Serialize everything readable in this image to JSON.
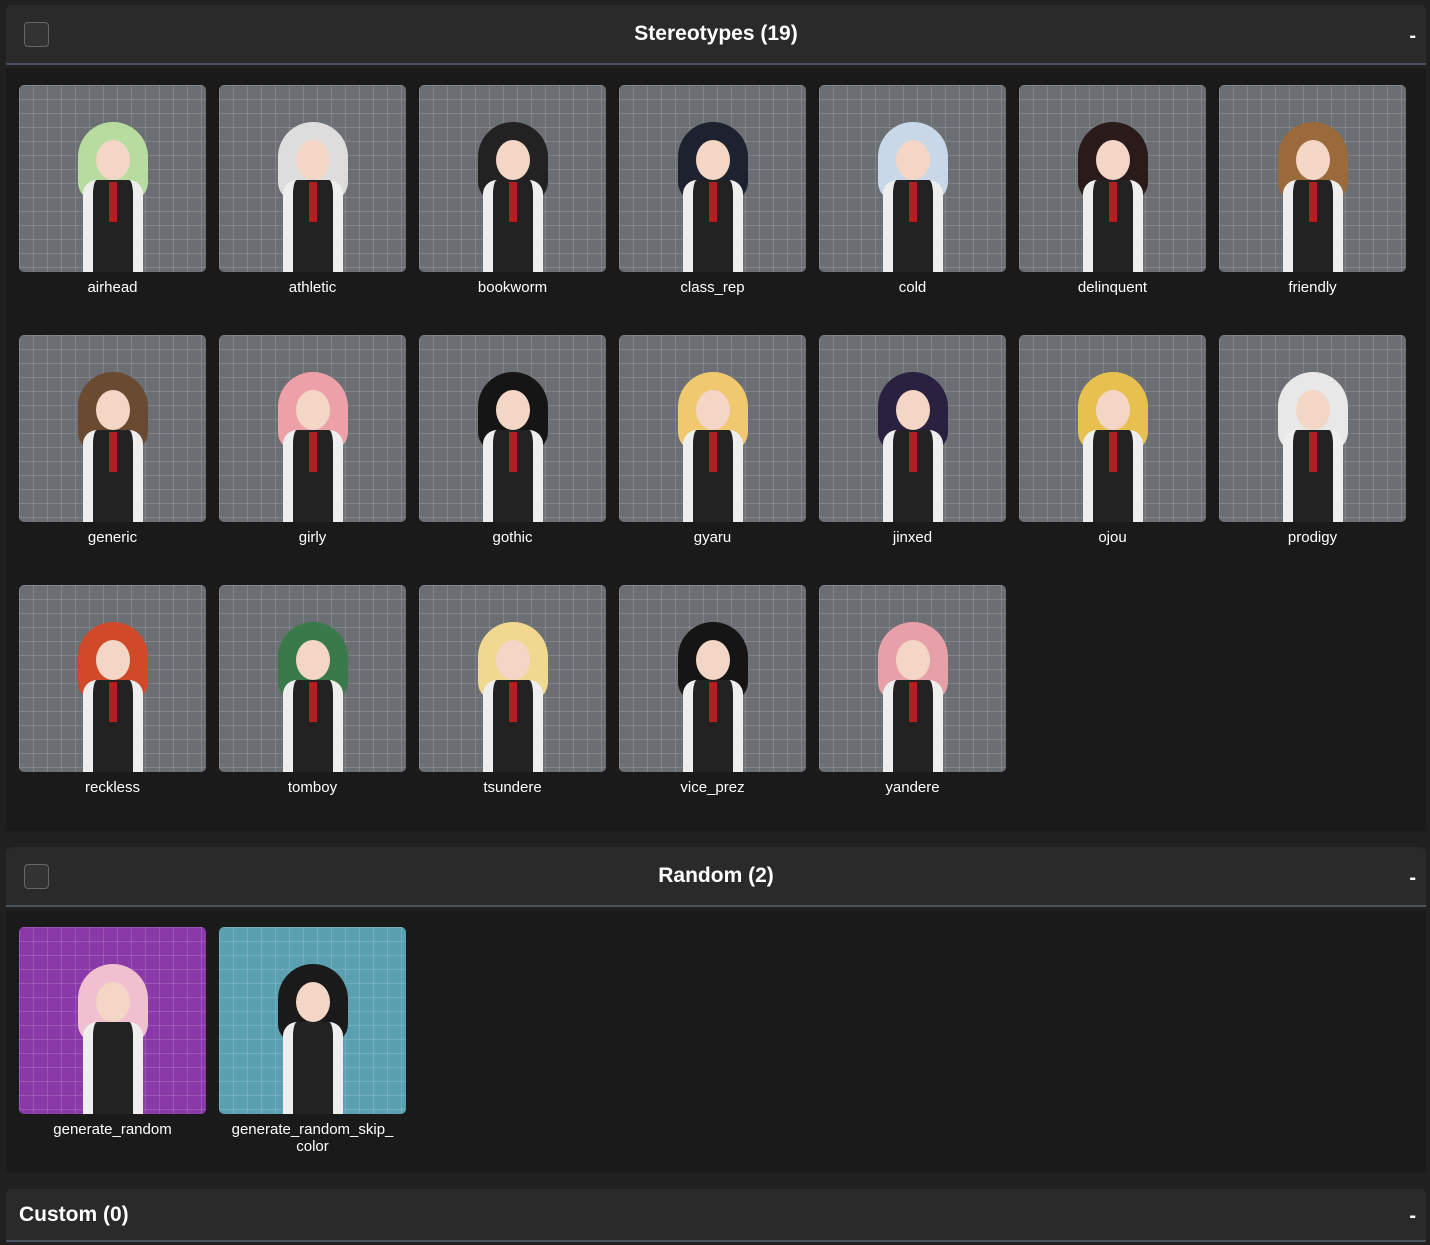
{
  "sections": [
    {
      "title": "Stereotypes (19)",
      "collapse": "-",
      "items": [
        {
          "label": "airhead",
          "hair": "#b8dca0"
        },
        {
          "label": "athletic",
          "hair": "#ddd"
        },
        {
          "label": "bookworm",
          "hair": "#222"
        },
        {
          "label": "class_rep",
          "hair": "#1e2230"
        },
        {
          "label": "cold",
          "hair": "#c8d8e8"
        },
        {
          "label": "delinquent",
          "hair": "#2a1a1a"
        },
        {
          "label": "friendly",
          "hair": "#9a6a3a"
        },
        {
          "label": "generic",
          "hair": "#6a4a30"
        },
        {
          "label": "girly",
          "hair": "#eea0a8"
        },
        {
          "label": "gothic",
          "hair": "#151515"
        },
        {
          "label": "gyaru",
          "hair": "#f0c870"
        },
        {
          "label": "jinxed",
          "hair": "#2a2040"
        },
        {
          "label": "ojou",
          "hair": "#e8c050"
        },
        {
          "label": "prodigy",
          "hair": "#e8e8e8"
        },
        {
          "label": "reckless",
          "hair": "#d04a2a"
        },
        {
          "label": "tomboy",
          "hair": "#3a7a4a"
        },
        {
          "label": "tsundere",
          "hair": "#f0d890"
        },
        {
          "label": "vice_prez",
          "hair": "#151515"
        },
        {
          "label": "yandere",
          "hair": "#e8a0a8"
        }
      ]
    },
    {
      "title": "Random (2)",
      "collapse": "-",
      "items": [
        {
          "label": "generate_random",
          "hair": "#f0c0d0"
        },
        {
          "label": "generate_random_skip_color",
          "hair": "#1a1a1a"
        }
      ]
    },
    {
      "title": "Custom (0)",
      "collapse": "-",
      "items": []
    }
  ]
}
